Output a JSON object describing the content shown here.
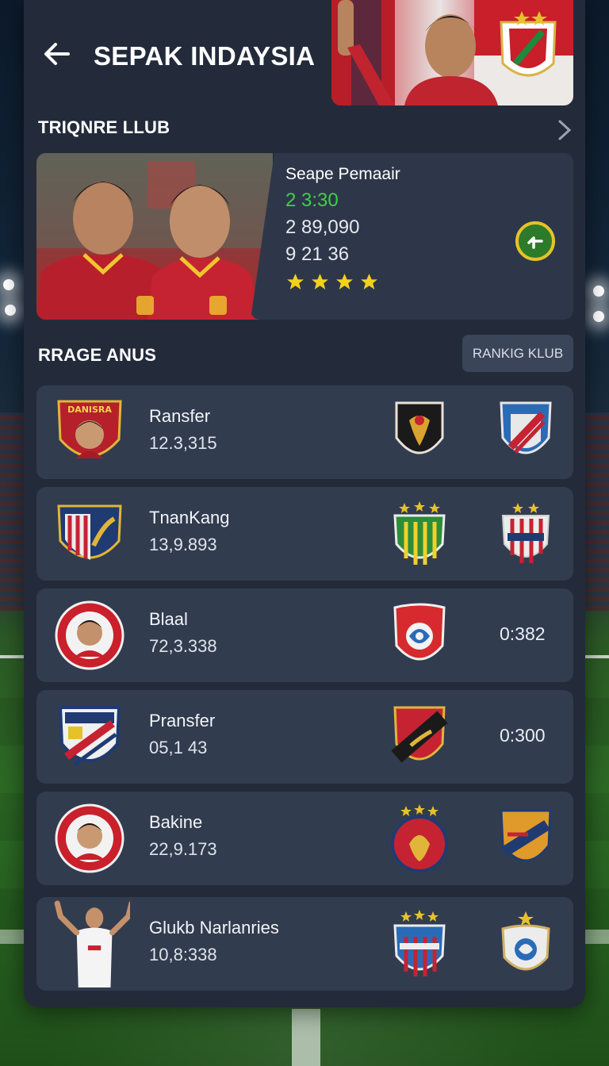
{
  "header": {
    "title": "SEPAK INDAYSIA"
  },
  "featured_section": {
    "title": "TRIQNRE LLUB"
  },
  "featured_card": {
    "title": "Seape Pemaair",
    "line1": "2  3:30",
    "line2": "2  89,090",
    "line3": "9  21 36",
    "rating_stars": 4
  },
  "ranking_section": {
    "title": "RRAGE ANUS",
    "button_label": "RANKIG KLUB"
  },
  "rows": [
    {
      "name": "Ransfer",
      "value": "12.3,315",
      "crest_text": "DANISRA",
      "score": ""
    },
    {
      "name": "TnanKang",
      "value": "13,9.893",
      "crest_text": "",
      "score": ""
    },
    {
      "name": "Blaal",
      "value": "72,3.338",
      "crest_text": "",
      "score": "0:382"
    },
    {
      "name": "Pransfer",
      "value": "05,1 43",
      "crest_text": "",
      "score": "0:300"
    },
    {
      "name": "Bakine",
      "value": "22,9.173",
      "crest_text": "",
      "score": ""
    },
    {
      "name": "Glukb Narlanries",
      "value": "10,8:338",
      "crest_text": "",
      "score": ""
    }
  ],
  "colors": {
    "panel": "#232b3a",
    "card": "#323c4f",
    "accent_green": "#3fcf4b",
    "star": "#f2d21b",
    "red": "#c81f2a"
  },
  "icons": [
    "back-arrow-icon",
    "chevron-right-icon",
    "star-icon",
    "check-icon"
  ]
}
